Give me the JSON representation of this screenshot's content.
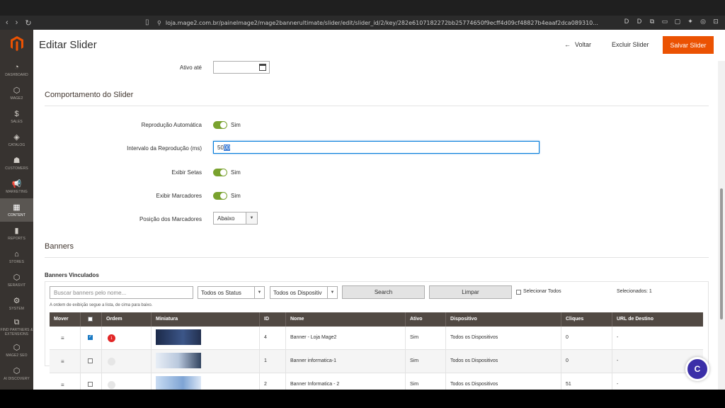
{
  "browser": {
    "url": "loja.mage2.com.br/painelmage2/mage2bannerultimate/slider/edit/slider_id/2/key/282e6107182272bb25774650f9ecff4d09cf48827b4eaaf2dca089310...",
    "extensions": [
      "D",
      "D",
      "⧉",
      "▭",
      "▢",
      "✦",
      "◎",
      "⊡"
    ]
  },
  "sidebar": {
    "items": [
      {
        "label": "DASHBOARD",
        "icon": "dashboard-icon",
        "glyph": "◔"
      },
      {
        "label": "MAGE2",
        "icon": "hexagon-icon",
        "glyph": "⬡"
      },
      {
        "label": "SALES",
        "icon": "dollar-icon",
        "glyph": "$"
      },
      {
        "label": "CATALOG",
        "icon": "cube-icon",
        "glyph": "◈"
      },
      {
        "label": "CUSTOMERS",
        "icon": "person-icon",
        "glyph": "☗"
      },
      {
        "label": "MARKETING",
        "icon": "megaphone-icon",
        "glyph": "📢"
      },
      {
        "label": "CONTENT",
        "icon": "content-icon",
        "glyph": "▦"
      },
      {
        "label": "REPORTS",
        "icon": "bar-chart-icon",
        "glyph": "▮"
      },
      {
        "label": "STORES",
        "icon": "store-icon",
        "glyph": "⌂"
      },
      {
        "label": "SERASVIT",
        "icon": "hexagon-icon",
        "glyph": "⬡"
      },
      {
        "label": "SYSTEM",
        "icon": "gear-icon",
        "glyph": "⚙"
      },
      {
        "label": "FIND PARTNERS & EXTENSIONS",
        "icon": "partners-icon",
        "glyph": "⧉"
      },
      {
        "label": "MAGE2 SEO",
        "icon": "hexagon-icon",
        "glyph": "⬡"
      },
      {
        "label": "AI DISCOVERY",
        "icon": "hexagon-icon",
        "glyph": "⬡"
      }
    ]
  },
  "header": {
    "title": "Editar Slider",
    "back_label": "Voltar",
    "delete_label": "Excluir Slider",
    "save_label": "Salvar Slider"
  },
  "form": {
    "active_until_label": "Ativo até",
    "behavior_title": "Comportamento do Slider",
    "autoplay_label": "Reprodução Automática",
    "autoplay_value": "Sim",
    "interval_label": "Intervalo da Reprodução (ms)",
    "interval_prefix": "50",
    "interval_selected": "00",
    "arrows_label": "Exibir Setas",
    "arrows_value": "Sim",
    "markers_label": "Exibir Marcadores",
    "markers_value": "Sim",
    "markers_position_label": "Posição dos Marcadores",
    "markers_position_value": "Abaixo"
  },
  "banners": {
    "title": "Banners",
    "linked_title": "Banners Vinculados",
    "search_placeholder": "Buscar banners pelo nome...",
    "status_filter": "Todos os Status",
    "device_filter": "Todos os Dispositiv",
    "search_btn": "Search",
    "clear_btn": "Limpar",
    "select_all": "Selecionar Todos",
    "selected_count": "Selecionados: 1",
    "hint": "A ordem de exibição segue a lista, de cima para baixo.",
    "columns": [
      "Mover",
      "",
      "Ordem",
      "Miniatura",
      "ID",
      "Nome",
      "Ativo",
      "Dispositivo",
      "Cliques",
      "URL de Destino"
    ],
    "rows": [
      {
        "drag": "≡",
        "checked": true,
        "order": "1",
        "id": "4",
        "name": "Banner - Loja Mage2",
        "active": "Sim",
        "device": "Todos os Dispositivos",
        "clicks": "0",
        "url": "-"
      },
      {
        "drag": "≡",
        "checked": false,
        "order": "",
        "id": "1",
        "name": "Banner informatica-1",
        "active": "Sim",
        "device": "Todos os Dispositivos",
        "clicks": "0",
        "url": "-"
      },
      {
        "drag": "≡",
        "checked": false,
        "order": "",
        "id": "2",
        "name": "Banner Informatica - 2",
        "active": "Sim",
        "device": "Todos os Dispositivos",
        "clicks": "51",
        "url": "-"
      }
    ]
  },
  "fab_label": "C"
}
